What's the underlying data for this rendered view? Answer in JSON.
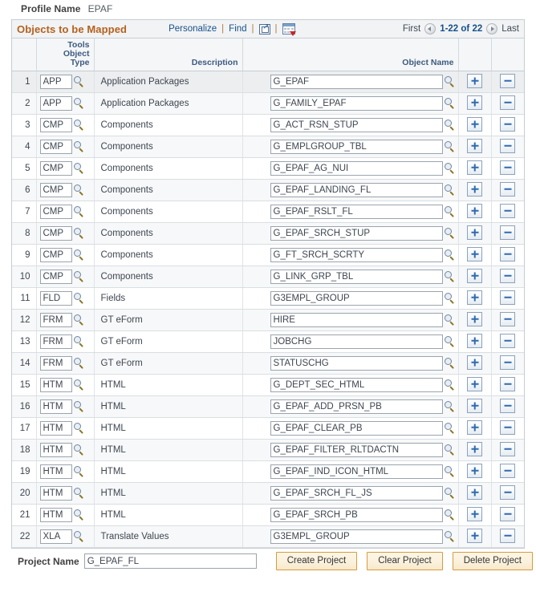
{
  "profile": {
    "label": "Profile Name",
    "value": "EPAF"
  },
  "grid": {
    "title": "Objects to be Mapped",
    "tools": {
      "personalize": "Personalize",
      "find": "Find",
      "sep1": "|",
      "sep2": "|",
      "sep3": "|",
      "expand_icon": "expand-window-icon",
      "download_icon": "download-to-spreadsheet-icon"
    },
    "pager": {
      "first": "First",
      "prev_icon": "previous-page-icon",
      "count": "1-22 of 22",
      "next_icon": "next-page-icon",
      "last": "Last"
    },
    "columns": {
      "row_number": "",
      "tools_object_type": "Tools Object\nType",
      "tools_object_type_line1": "Tools Object",
      "tools_object_type_line2": "Type",
      "description": "Description",
      "object_name": "Object Name",
      "add": "",
      "remove": ""
    },
    "row_buttons": {
      "add_label": "+",
      "remove_label": "-",
      "add_name": "add-row-button",
      "remove_name": "delete-row-button"
    },
    "lookup_icon": "lookup-magnifier-icon",
    "rows": [
      {
        "num": "1",
        "type": "APP",
        "description": "Application Packages",
        "object_name": "G_EPAF"
      },
      {
        "num": "2",
        "type": "APP",
        "description": "Application Packages",
        "object_name": "G_FAMILY_EPAF"
      },
      {
        "num": "3",
        "type": "CMP",
        "description": "Components",
        "object_name": "G_ACT_RSN_STUP"
      },
      {
        "num": "4",
        "type": "CMP",
        "description": "Components",
        "object_name": "G_EMPLGROUP_TBL"
      },
      {
        "num": "5",
        "type": "CMP",
        "description": "Components",
        "object_name": "G_EPAF_AG_NUI"
      },
      {
        "num": "6",
        "type": "CMP",
        "description": "Components",
        "object_name": "G_EPAF_LANDING_FL"
      },
      {
        "num": "7",
        "type": "CMP",
        "description": "Components",
        "object_name": "G_EPAF_RSLT_FL"
      },
      {
        "num": "8",
        "type": "CMP",
        "description": "Components",
        "object_name": "G_EPAF_SRCH_STUP"
      },
      {
        "num": "9",
        "type": "CMP",
        "description": "Components",
        "object_name": "G_FT_SRCH_SCRTY"
      },
      {
        "num": "10",
        "type": "CMP",
        "description": "Components",
        "object_name": "G_LINK_GRP_TBL"
      },
      {
        "num": "11",
        "type": "FLD",
        "description": "Fields",
        "object_name": "G3EMPL_GROUP"
      },
      {
        "num": "12",
        "type": "FRM",
        "description": "GT eForm",
        "object_name": "HIRE"
      },
      {
        "num": "13",
        "type": "FRM",
        "description": "GT eForm",
        "object_name": "JOBCHG"
      },
      {
        "num": "14",
        "type": "FRM",
        "description": "GT eForm",
        "object_name": "STATUSCHG"
      },
      {
        "num": "15",
        "type": "HTM",
        "description": "HTML",
        "object_name": "G_DEPT_SEC_HTML"
      },
      {
        "num": "16",
        "type": "HTM",
        "description": "HTML",
        "object_name": "G_EPAF_ADD_PRSN_PB"
      },
      {
        "num": "17",
        "type": "HTM",
        "description": "HTML",
        "object_name": "G_EPAF_CLEAR_PB"
      },
      {
        "num": "18",
        "type": "HTM",
        "description": "HTML",
        "object_name": "G_EPAF_FILTER_RLTDACTN"
      },
      {
        "num": "19",
        "type": "HTM",
        "description": "HTML",
        "object_name": "G_EPAF_IND_ICON_HTML"
      },
      {
        "num": "20",
        "type": "HTM",
        "description": "HTML",
        "object_name": "G_EPAF_SRCH_FL_JS"
      },
      {
        "num": "21",
        "type": "HTM",
        "description": "HTML",
        "object_name": "G_EPAF_SRCH_PB"
      },
      {
        "num": "22",
        "type": "XLA",
        "description": "Translate Values",
        "object_name": "G3EMPL_GROUP"
      }
    ]
  },
  "footer": {
    "project_label": "Project Name",
    "project_value": "G_EPAF_FL",
    "buttons": [
      {
        "label": "Create Project",
        "name": "create-project-button"
      },
      {
        "label": "Clear Project",
        "name": "clear-project-button"
      },
      {
        "label": "Delete Project",
        "name": "delete-project-button"
      }
    ]
  },
  "colors": {
    "grid_title": "#b4611d",
    "link": "#14518c",
    "header_text": "#3d5a80",
    "button_border": "#d99b3c",
    "button_fill": "#fdf6e6",
    "row_btn_glyph": "#2f6bb0"
  }
}
